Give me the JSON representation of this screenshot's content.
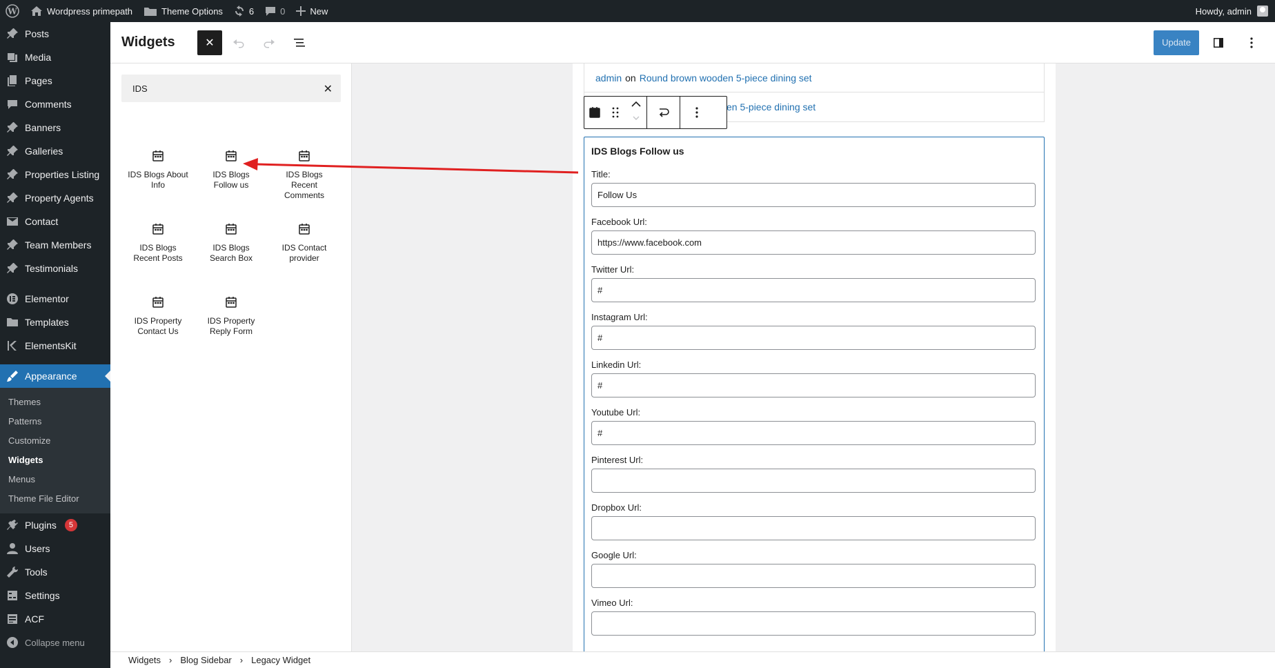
{
  "admin_bar": {
    "site_name": "Wordpress primepath",
    "theme_options": "Theme Options",
    "updates_count": "6",
    "comments_count": "0",
    "new_label": "New",
    "howdy": "Howdy, admin"
  },
  "sidebar": {
    "items": [
      {
        "label": "Posts",
        "icon": "pin-icon"
      },
      {
        "label": "Media",
        "icon": "media-icon"
      },
      {
        "label": "Pages",
        "icon": "pages-icon"
      },
      {
        "label": "Comments",
        "icon": "comment-icon"
      },
      {
        "label": "Banners",
        "icon": "pin-icon"
      },
      {
        "label": "Galleries",
        "icon": "pin-icon"
      },
      {
        "label": "Properties Listing",
        "icon": "pin-icon"
      },
      {
        "label": "Property Agents",
        "icon": "pin-icon"
      },
      {
        "label": "Contact",
        "icon": "mail-icon"
      },
      {
        "label": "Team Members",
        "icon": "pin-icon"
      },
      {
        "label": "Testimonials",
        "icon": "pin-icon"
      },
      {
        "label": "Elementor",
        "icon": "elementor-icon"
      },
      {
        "label": "Templates",
        "icon": "folder-icon"
      },
      {
        "label": "ElementsKit",
        "icon": "elementskit-icon"
      },
      {
        "label": "Appearance",
        "icon": "brush-icon"
      }
    ],
    "submenu": [
      "Themes",
      "Patterns",
      "Customize",
      "Widgets",
      "Menus",
      "Theme File Editor"
    ],
    "bottom_items": [
      {
        "label": "Plugins",
        "icon": "plugin-icon",
        "badge": "5"
      },
      {
        "label": "Users",
        "icon": "user-icon"
      },
      {
        "label": "Tools",
        "icon": "wrench-icon"
      },
      {
        "label": "Settings",
        "icon": "settings-icon"
      },
      {
        "label": "ACF",
        "icon": "acf-icon"
      }
    ],
    "collapse": "Collapse menu"
  },
  "header": {
    "title": "Widgets",
    "update_label": "Update"
  },
  "inserter": {
    "search_value": "IDS",
    "blocks": [
      "IDS Blogs About Info",
      "IDS Blogs Follow us",
      "IDS Blogs Recent Comments",
      "IDS Blogs Recent Posts",
      "IDS Blogs Search Box",
      "IDS Contact provider",
      "IDS Property Contact Us",
      "IDS Property Reply Form"
    ]
  },
  "canvas": {
    "recent_comments": [
      {
        "author": "admin",
        "on": "on",
        "post": "Round brown wooden 5-piece dining set"
      },
      {
        "author": "",
        "on": "",
        "post": "en 5-piece dining set"
      }
    ],
    "widget": {
      "title": "IDS Blogs Follow us",
      "fields": [
        {
          "label": "Title:",
          "value": "Follow Us"
        },
        {
          "label": "Facebook Url:",
          "value": "https://www.facebook.com"
        },
        {
          "label": "Twitter Url:",
          "value": "#"
        },
        {
          "label": "Instagram Url:",
          "value": "#"
        },
        {
          "label": "Linkedin Url:",
          "value": "#"
        },
        {
          "label": "Youtube Url:",
          "value": "#"
        },
        {
          "label": "Pinterest Url:",
          "value": ""
        },
        {
          "label": "Dropbox Url:",
          "value": ""
        },
        {
          "label": "Google Url:",
          "value": ""
        },
        {
          "label": "Vimeo Url:",
          "value": ""
        }
      ]
    }
  },
  "breadcrumb": [
    "Widgets",
    "Blog Sidebar",
    "Legacy Widget"
  ],
  "colors": {
    "admin_dark": "#1d2327",
    "accent": "#2271b1",
    "arrow": "#e02020"
  }
}
